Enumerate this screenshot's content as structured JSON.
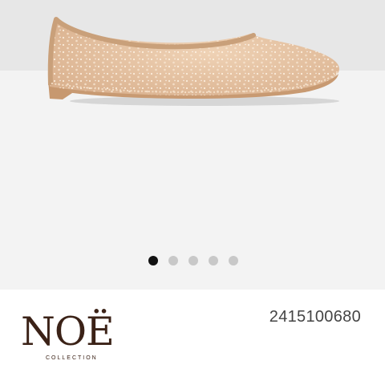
{
  "gallery": {
    "image_count": 5,
    "active_index": 0,
    "image_alt": "ballet flat shoe"
  },
  "brand": {
    "name": "NOË",
    "subline": "COLLECTION"
  },
  "product": {
    "sku": "2415100680"
  },
  "colors": {
    "shoe_body": "#e6c3a2",
    "shoe_trim": "#c9a07a",
    "brand": "#3b2217",
    "dot_active": "#111111",
    "dot_inactive": "#c8c8c8"
  }
}
